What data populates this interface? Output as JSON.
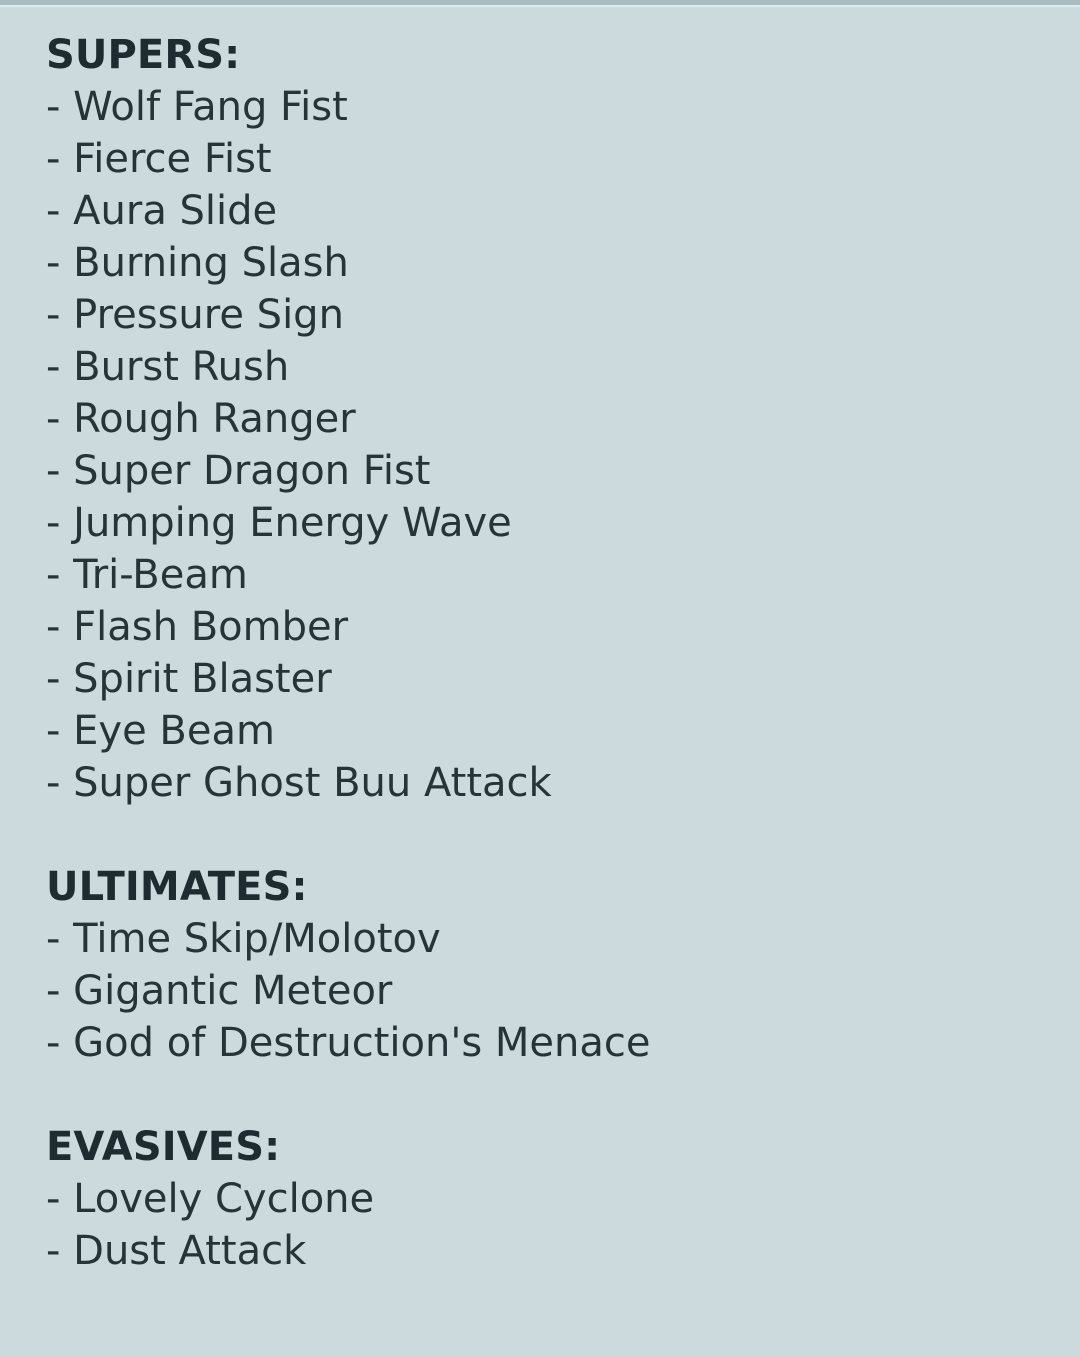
{
  "note": {
    "background_color": "#ccdade",
    "text_color": "#26343a",
    "heading_color": "#1e2b30",
    "bullet_prefix": "- ",
    "sections": [
      {
        "heading": "SUPERS:",
        "items": [
          "Wolf Fang Fist",
          "Fierce Fist",
          "Aura Slide",
          "Burning Slash",
          "Pressure Sign",
          "Burst Rush",
          "Rough Ranger",
          "Super Dragon Fist",
          "Jumping Energy Wave",
          "Tri-Beam",
          "Flash Bomber",
          "Spirit Blaster",
          "Eye Beam",
          "Super Ghost Buu Attack"
        ]
      },
      {
        "heading": "ULTIMATES:",
        "items": [
          "Time Skip/Molotov",
          "Gigantic Meteor",
          "God of Destruction's Menace"
        ]
      },
      {
        "heading": "EVASIVES:",
        "items": [
          "Lovely Cyclone",
          "Dust Attack"
        ]
      }
    ]
  }
}
